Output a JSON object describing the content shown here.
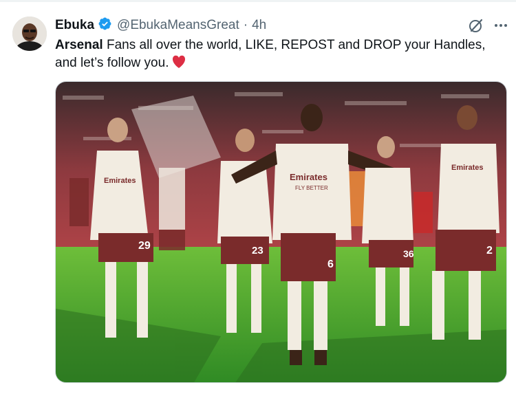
{
  "tweet": {
    "author_name": "Ebuka",
    "handle": "@EbukaMeansGreat",
    "separator": "·",
    "time": "4h",
    "text_bold": "Arsenal",
    "text_rest": " Fans all over the world, LIKE, REPOST and DROP your Handles, and let’s follow you.",
    "emoji": "heart-emoji"
  },
  "image": {
    "description_icon": "photo",
    "shirt_sponsor": "Emirates",
    "shirt_slogan": "FLY BETTER",
    "numbers": [
      "29",
      "23",
      "6",
      "36",
      "2"
    ]
  },
  "colors": {
    "verified": "#1d9bf0",
    "heart": "#f91880",
    "grass": "#3f9b2a",
    "kit_shirt": "#f2ece1",
    "kit_shorts": "#7a2b2b",
    "stand": "#c6464b"
  }
}
